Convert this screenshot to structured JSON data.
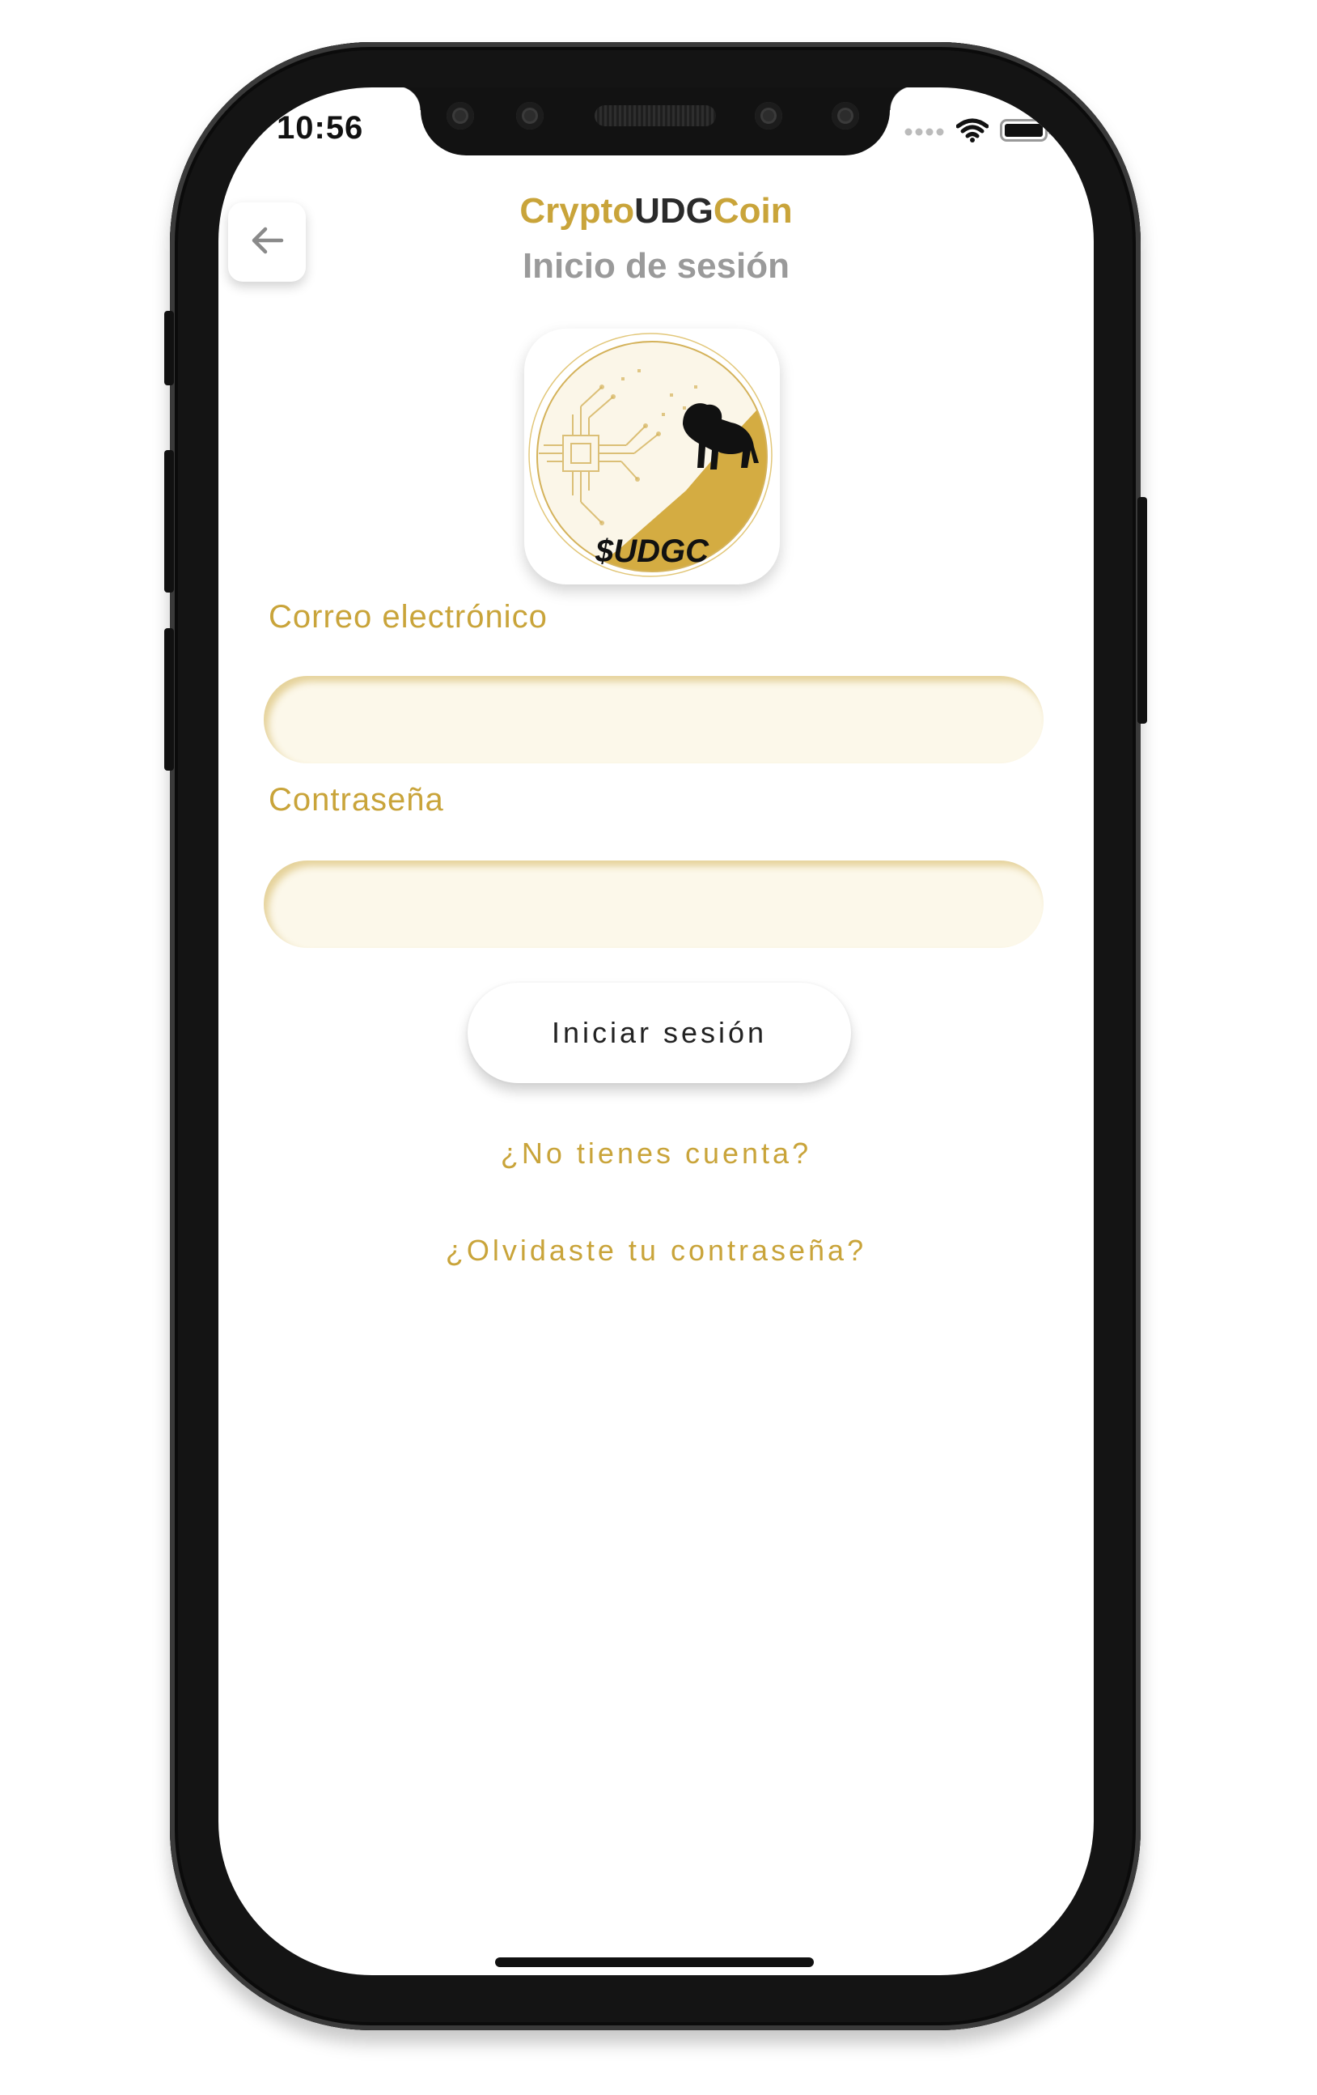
{
  "status_bar": {
    "time": "10:56"
  },
  "header": {
    "title_part1": "Crypto",
    "title_part2": "UDG",
    "title_part3": "Coin",
    "subtitle": "Inicio de sesión"
  },
  "logo": {
    "ticker": "$UDGC"
  },
  "form": {
    "email_label": "Correo electrónico",
    "email_value": "",
    "password_label": "Contraseña",
    "password_value": ""
  },
  "actions": {
    "login_label": "Iniciar sesión",
    "no_account_link": "¿No tienes cuenta?",
    "forgot_password_link": "¿Olvidaste tu contraseña?"
  },
  "colors": {
    "accent_gold": "#c9a43a",
    "dark_text": "#2a2a2a",
    "muted_text": "#9a9a9a",
    "input_bg": "#fcf8ea"
  },
  "icons": [
    "back-arrow-icon",
    "signal-dots-icon",
    "wifi-icon",
    "battery-icon"
  ]
}
